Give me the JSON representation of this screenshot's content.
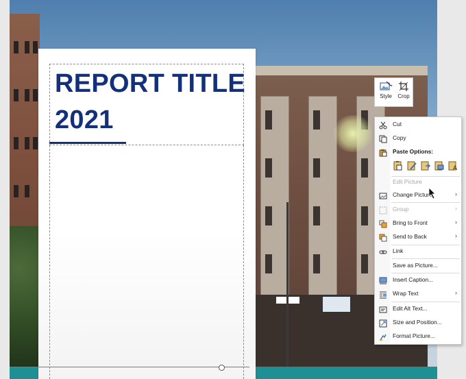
{
  "report": {
    "title": "REPORT TITLE\n2021"
  },
  "mini_toolbar": {
    "style_label": "Style",
    "crop_label": "Crop"
  },
  "context_menu": {
    "cut": "Cut",
    "copy": "Copy",
    "paste_options_header": "Paste Options:",
    "edit_picture": "Edit Picture",
    "change_picture": "Change Picture",
    "group": "Group",
    "bring_to_front": "Bring to Front",
    "send_to_back": "Send to Back",
    "link": "Link",
    "save_as_picture": "Save as Picture...",
    "insert_caption": "Insert Caption...",
    "wrap_text": "Wrap Text",
    "edit_alt_text": "Edit Alt Text...",
    "size_and_position": "Size and Position...",
    "format_picture": "Format Picture..."
  },
  "colors": {
    "title_blue": "#13307a",
    "teal_band": "#1e8f93"
  }
}
